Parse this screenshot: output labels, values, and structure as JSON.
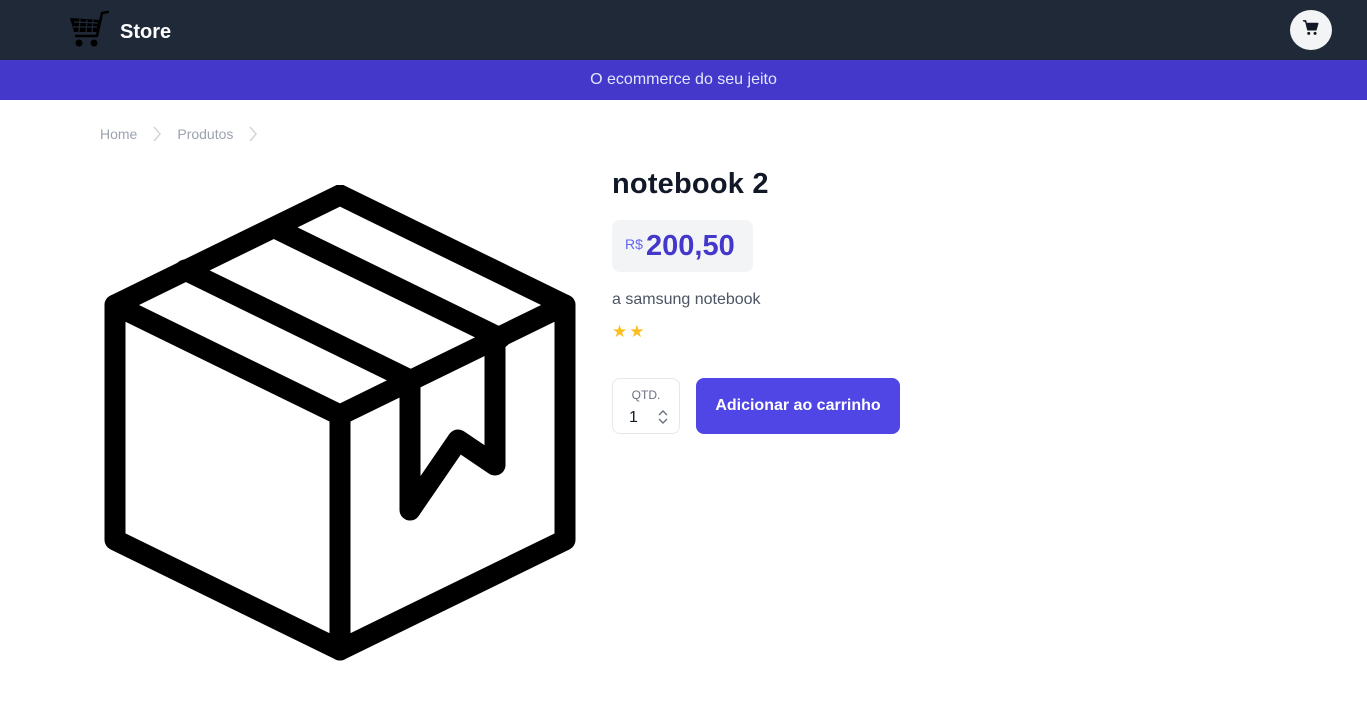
{
  "header": {
    "brand_name": "Store",
    "logo_icon": "shopping-cart-icon",
    "cart_icon": "cart-icon"
  },
  "banner": {
    "text": "O ecommerce do seu jeito"
  },
  "breadcrumb": [
    {
      "label": "Home"
    },
    {
      "label": "Produtos"
    }
  ],
  "product": {
    "image_icon": "package-box-icon",
    "title": "notebook 2",
    "currency": "R$",
    "price": "200,50",
    "description": "a samsung notebook",
    "rating": {
      "stars": 2,
      "glyph": "⭐"
    }
  },
  "purchase": {
    "qty_label": "QTD.",
    "qty_value": "1",
    "add_button_label": "Adicionar ao carrinho"
  },
  "colors": {
    "header_bg": "#1f2937",
    "banner_bg": "#4338ca",
    "accent": "#4f46e5",
    "star": "#fbbf24"
  }
}
